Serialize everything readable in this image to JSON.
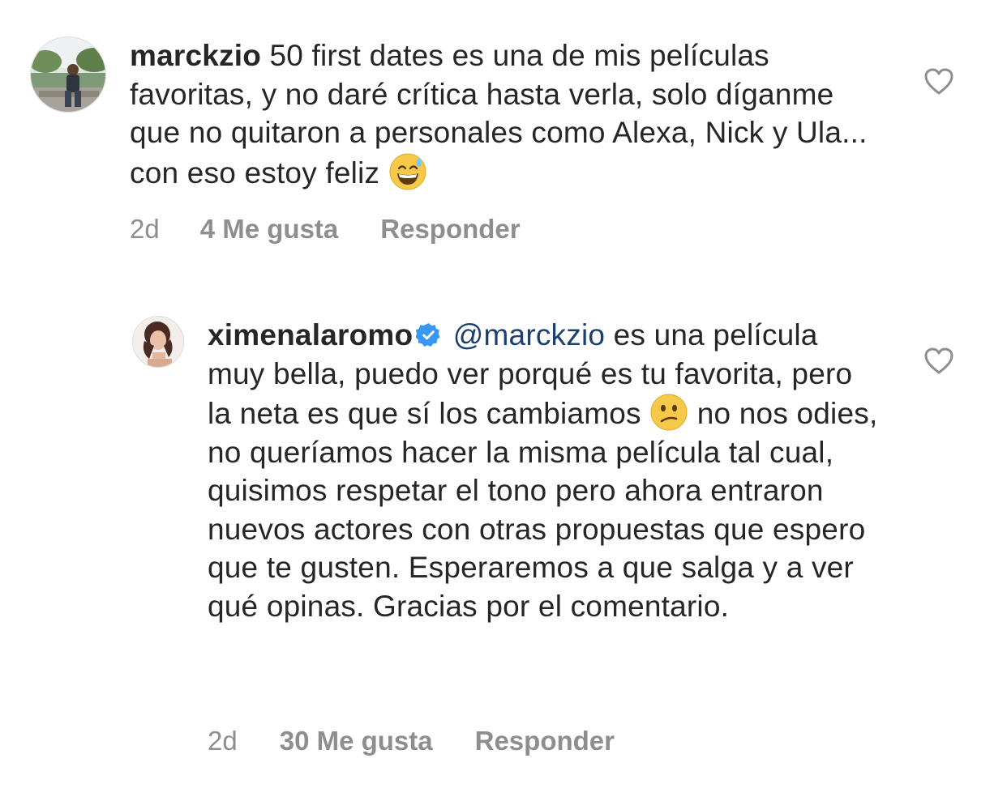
{
  "comments": [
    {
      "username": "marckzio",
      "verified": false,
      "mention": "",
      "text_before_emoji": "50 first dates es una de mis películas favoritas, y no daré crítica hasta verla, solo díganme que no quitaron a personales como Alexa, Nick y Ula... con eso estoy feliz",
      "emoji": "grinning-face-with-sweat",
      "text_after_emoji": "",
      "time": "2d",
      "likes": "4 Me gusta",
      "reply": "Responder",
      "avatar_icon": "user-photo-avatar"
    },
    {
      "username": "ximenalaromo",
      "verified": true,
      "mention": "@marckzio",
      "text_before_emoji": "es una película muy bella, puedo ver porqué es tu favorita, pero la neta es que sí los cambiamos",
      "emoji": "confused-face",
      "text_after_emoji": "no nos odies, no queríamos hacer la misma película tal cual, quisimos respetar el tono pero ahora entraron nuevos actores con otras propuestas que espero que te gusten. Esperaremos a que salga y a ver qué opinas. Gracias por el comentario.",
      "time": "2d",
      "likes": "30 Me gusta",
      "reply": "Responder",
      "avatar_icon": "user-photo-avatar"
    }
  ],
  "colors": {
    "text": "#262626",
    "meta": "#8e8e8e",
    "mention": "#1c3f72",
    "verified": "#3897f0",
    "heart_outline": "#8e8e8e"
  }
}
